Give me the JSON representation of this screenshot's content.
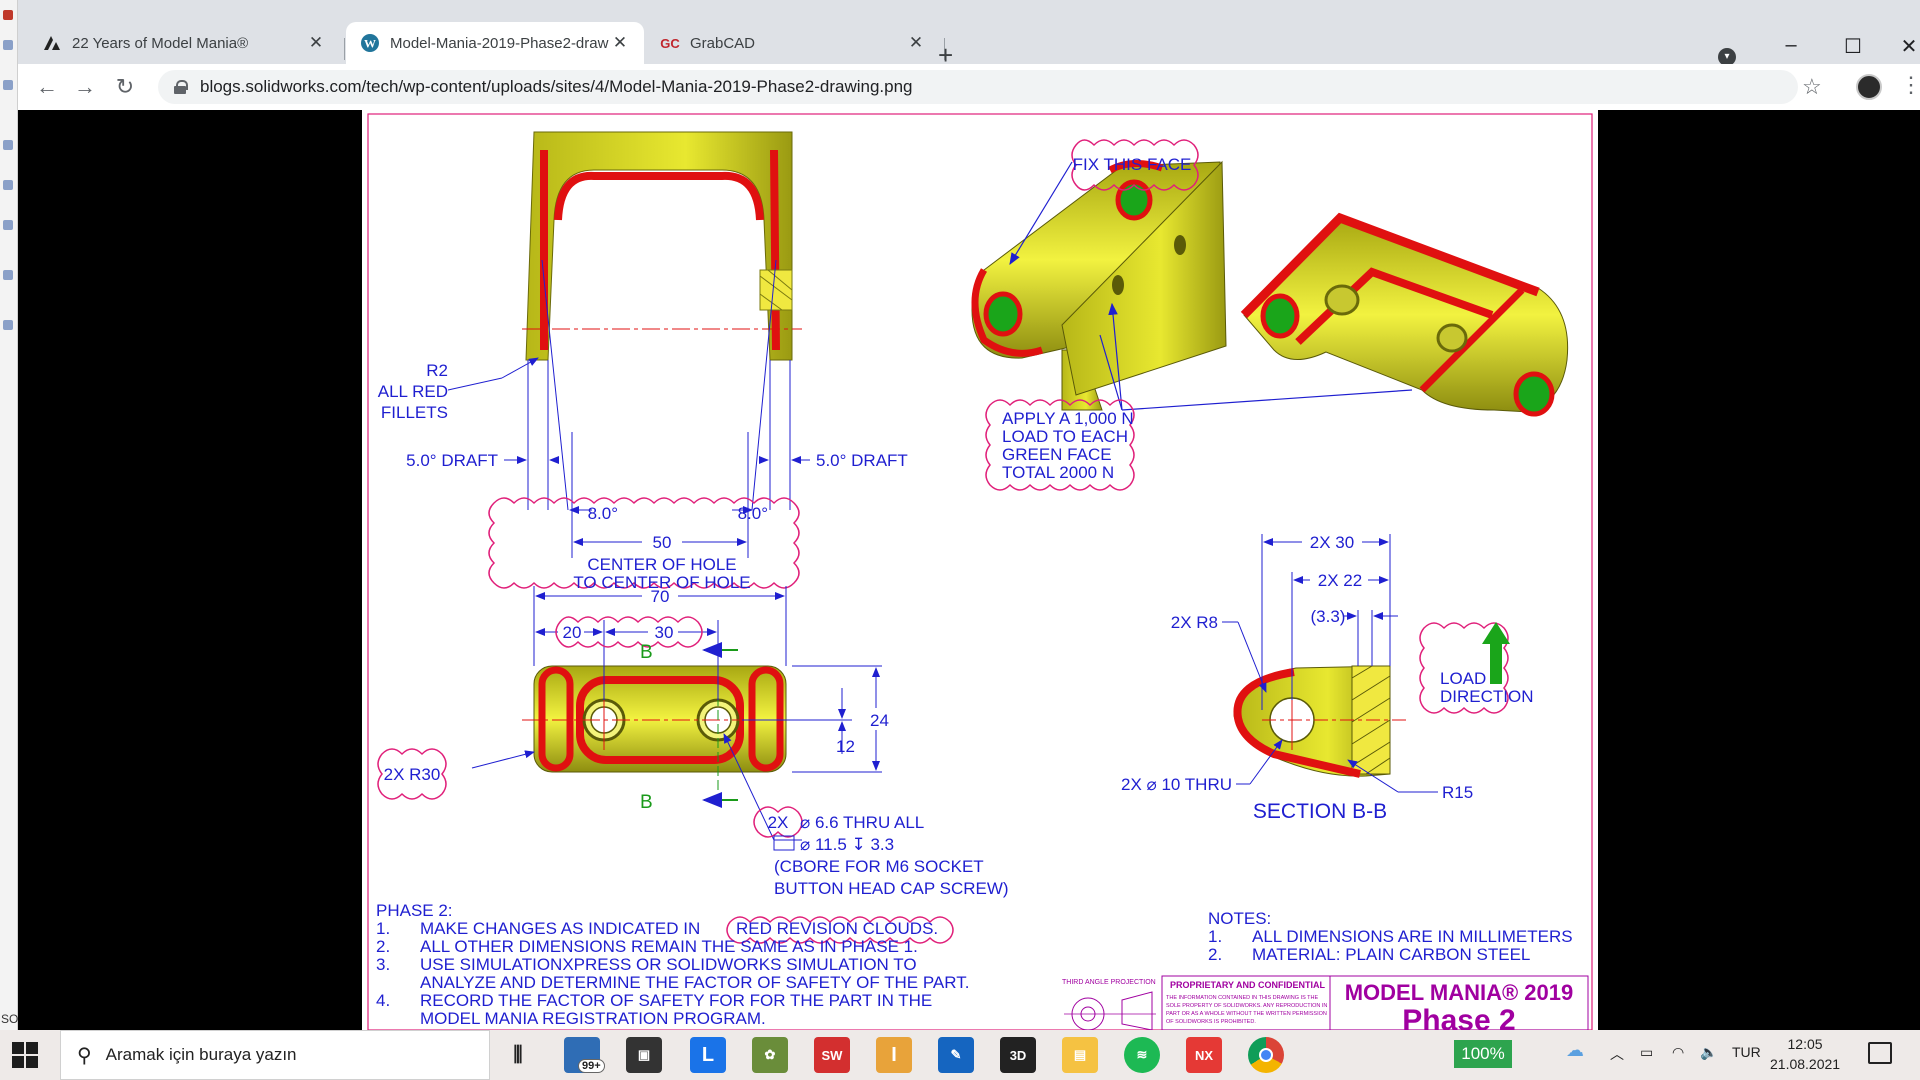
{
  "browser": {
    "tabs": [
      {
        "label": "22 Years of Model Mania®",
        "favicon": "solidworks-icon"
      },
      {
        "label": "Model-Mania-2019-Phase2-draw",
        "favicon": "wordpress-icon",
        "active": true
      },
      {
        "label": "GrabCAD",
        "favicon_text": "GC"
      }
    ],
    "url": "blogs.solidworks.com/tech/wp-content/uploads/sites/4/Model-Mania-2019-Phase2-drawing.png",
    "window_controls": {
      "minimize": "–",
      "maximize": "☐",
      "close": "✕"
    },
    "new_tab": "+"
  },
  "drawing": {
    "top_left": {
      "r2": "R2",
      "all_red": "ALL RED",
      "fillets": "FILLETS",
      "draft_left": "5.0° DRAFT",
      "draft_right": "5.0° DRAFT",
      "angle_left": "8.0°",
      "angle_right": "8.0°",
      "dim_50": "50",
      "center_line1": "CENTER OF HOLE",
      "center_line2": "TO CENTER OF HOLE"
    },
    "top_right": {
      "fix_face": "FIX THIS FACE",
      "load1": "APPLY A 1,000 N",
      "load2": "LOAD TO EACH",
      "load3": "GREEN FACE",
      "load4": "TOTAL 2000 N"
    },
    "bottom_left": {
      "dim_70": "70",
      "dim_20": "20",
      "dim_30": "30",
      "section_b": "B",
      "dim_24": "24",
      "dim_12": "12",
      "r30": "2X R30",
      "hole_qty": "2X",
      "hole1": "⌀ 6.6 THRU ALL",
      "hole2": "⌀ 11.5 ↧ 3.3",
      "hole3": "(CBORE FOR M6 SOCKET",
      "hole4": "BUTTON HEAD CAP SCREW)"
    },
    "bottom_right": {
      "dim_2x30": "2X 30",
      "dim_2x22": "2X 22",
      "dim_33": "(3.3)",
      "r8": "2X R8",
      "thru": "2X ⌀ 10 THRU",
      "r15": "R15",
      "section_title": "SECTION B-B",
      "load_dir1": "LOAD",
      "load_dir2": "DIRECTION"
    },
    "phase_notes": {
      "heading": "PHASE 2:",
      "items": [
        {
          "num": "1.",
          "text": "MAKE CHANGES AS INDICATED IN",
          "cloud": "RED REVISION CLOUDS."
        },
        {
          "num": "2.",
          "text": "ALL OTHER DIMENSIONS REMAIN THE SAME AS IN PHASE 1."
        },
        {
          "num": "3.",
          "text": "USE SIMULATIONXPRESS OR SOLIDWORKS SIMULATION TO"
        },
        {
          "num": "",
          "text": "ANALYZE AND DETERMINE THE FACTOR OF SAFETY OF THE PART."
        },
        {
          "num": "4.",
          "text": "RECORD THE FACTOR OF SAFETY FOR FOR THE PART IN THE"
        },
        {
          "num": "",
          "text": "MODEL MANIA REGISTRATION PROGRAM."
        }
      ]
    },
    "notes": {
      "heading": "NOTES:",
      "items": [
        {
          "num": "1.",
          "text": "ALL DIMENSIONS ARE IN MILLIMETERS"
        },
        {
          "num": "2.",
          "text": "MATERIAL: PLAIN CARBON STEEL"
        }
      ]
    },
    "title_block": {
      "projection": "THIRD ANGLE PROJECTION",
      "proprietary": "PROPRIETARY AND CONFIDENTIAL",
      "prop_body1": "THE INFORMATION CONTAINED IN THIS DRAWING IS THE",
      "prop_body2": "SOLE PROPERTY OF SOLIDWORKS. ANY REPRODUCTION IN",
      "prop_body3": "PART OR AS A WHOLE WITHOUT THE WRITTEN PERMISSION",
      "prop_body4": "OF SOLIDWORKS IS PROHIBITED.",
      "brand": "MODEL MANIA® 2019",
      "phase": "Phase 2"
    }
  },
  "taskbar": {
    "search_placeholder": "Aramak için buraya yazın",
    "mail_badge": "99+",
    "zoom": "100%",
    "language": "TUR",
    "time": "12:05",
    "date": "21.08.2021",
    "left_strip_label": "SO"
  },
  "colors": {
    "dimension": "#1f1fd0",
    "revision_cloud": "#e0207a",
    "part_yellow": "#d8d81e",
    "fillet_red": "#e01010",
    "face_green": "#1aa51a",
    "brand": "#a000a0"
  }
}
